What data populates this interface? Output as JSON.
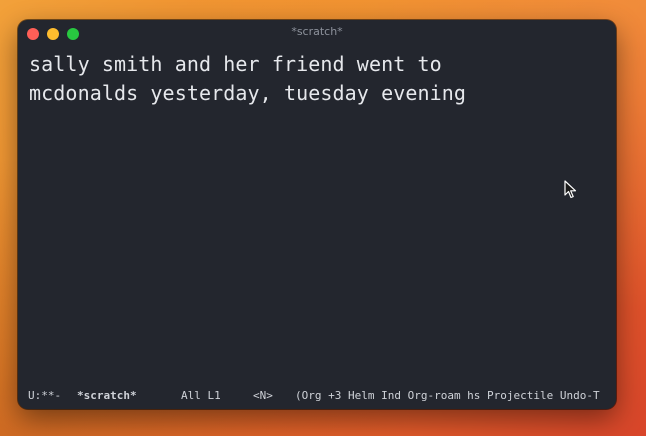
{
  "window": {
    "title": "*scratch*"
  },
  "buffer": {
    "lines": [
      "sally smith and her friend went to",
      "mcdonalds yesterday, tuesday evening"
    ]
  },
  "modeline": {
    "status": "U:**-",
    "buffer_name": "*scratch*",
    "position": "All L1",
    "state": "<N>",
    "modes": "(Org +3 Helm Ind Org-roam hs Projectile Undo-T"
  },
  "icons": {
    "close": "close-window-icon",
    "minimize": "minimize-window-icon",
    "maximize": "maximize-window-icon",
    "pointer": "mouse-pointer-icon"
  },
  "colors": {
    "window_bg": "#23262e",
    "text": "#e6e8ec",
    "close": "#ff5f57",
    "minimize": "#febc2e",
    "maximize": "#28c840"
  }
}
